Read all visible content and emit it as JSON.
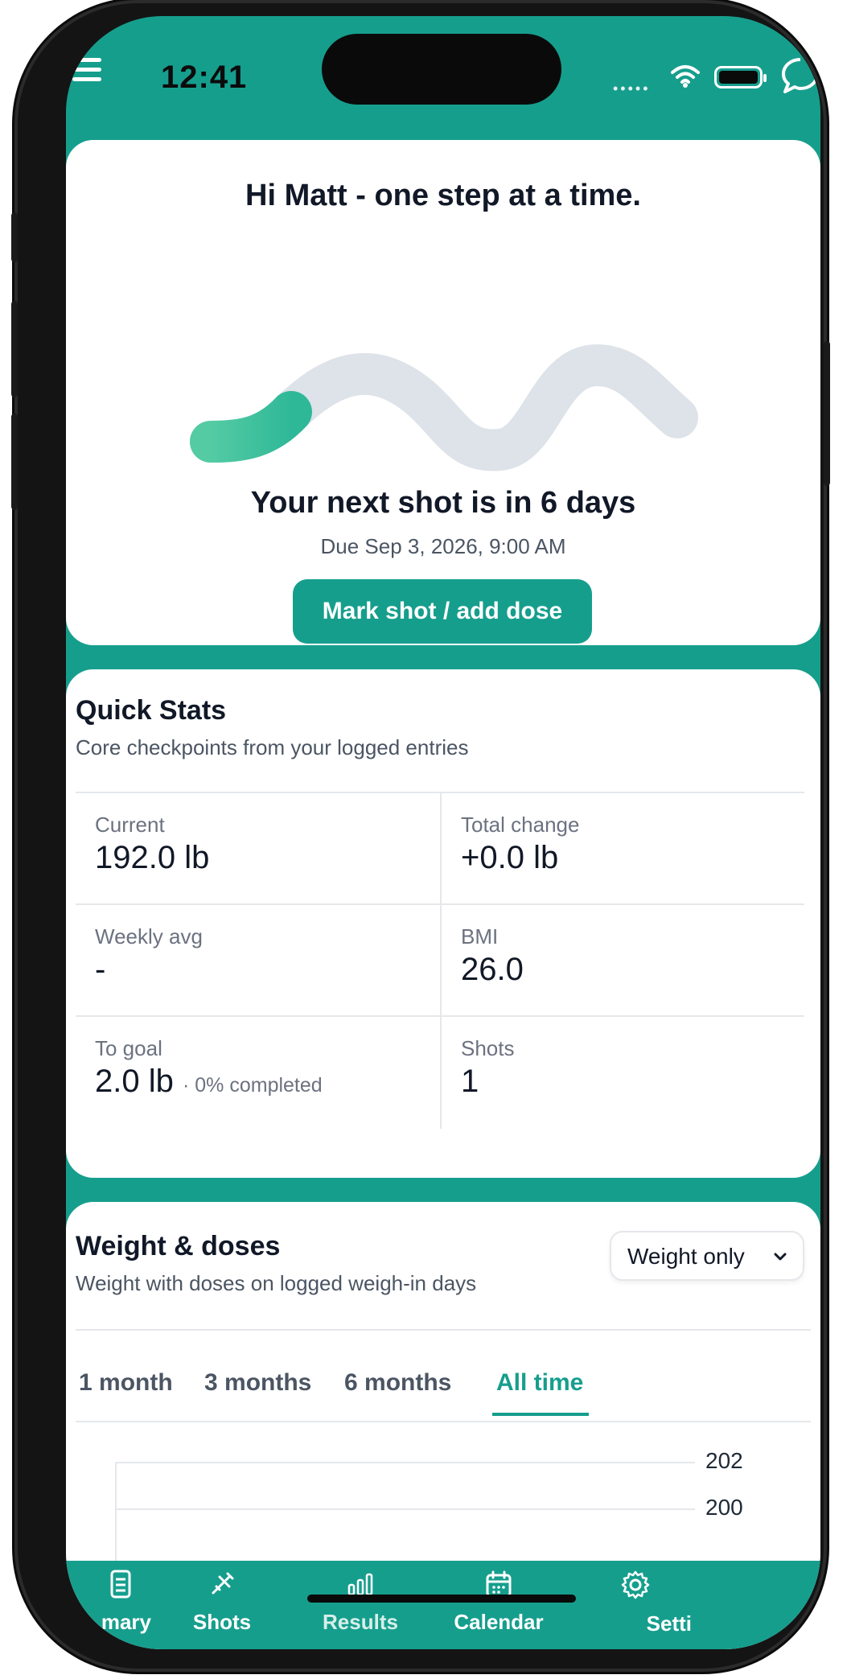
{
  "status_bar": {
    "time": "12:41",
    "signal_dots": "•••••"
  },
  "hero": {
    "greeting": "Hi Matt - one step at a time.",
    "next_shot": "Your next shot is in 6 days",
    "due": "Due Sep 3, 2026, 9:00 AM",
    "button_label": "Mark shot / add dose"
  },
  "quick_stats": {
    "title": "Quick Stats",
    "subtitle": "Core checkpoints from your logged entries",
    "cells": [
      {
        "label": "Current",
        "value": "192.0 lb",
        "note": ""
      },
      {
        "label": "Total change",
        "value": "+0.0 lb",
        "note": ""
      },
      {
        "label": "Weekly avg",
        "value": "-",
        "note": ""
      },
      {
        "label": "BMI",
        "value": "26.0",
        "note": ""
      },
      {
        "label": "To goal",
        "value": "2.0 lb",
        "note": "· 0% completed"
      },
      {
        "label": "Shots",
        "value": "1",
        "note": ""
      }
    ]
  },
  "weight_doses": {
    "title": "Weight & doses",
    "subtitle": "Weight with doses on logged weigh-in days",
    "select_value": "Weight only",
    "tabs": [
      "1 month",
      "3 months",
      "6 months",
      "All time"
    ],
    "active_tab": "All time",
    "y_ticks": [
      "202",
      "200"
    ]
  },
  "bottom_nav": {
    "items": [
      {
        "label": "mary",
        "icon": "summary-icon"
      },
      {
        "label": "Shots",
        "icon": "syringe-icon"
      },
      {
        "label": "Results",
        "icon": "bar-chart-icon"
      },
      {
        "label": "Calendar",
        "icon": "calendar-icon"
      },
      {
        "label": "Setti",
        "icon": "gear-icon"
      }
    ]
  },
  "colors": {
    "accent": "#169e8d",
    "text": "#111827",
    "muted": "#4b5563",
    "track": "#dde3e8"
  }
}
